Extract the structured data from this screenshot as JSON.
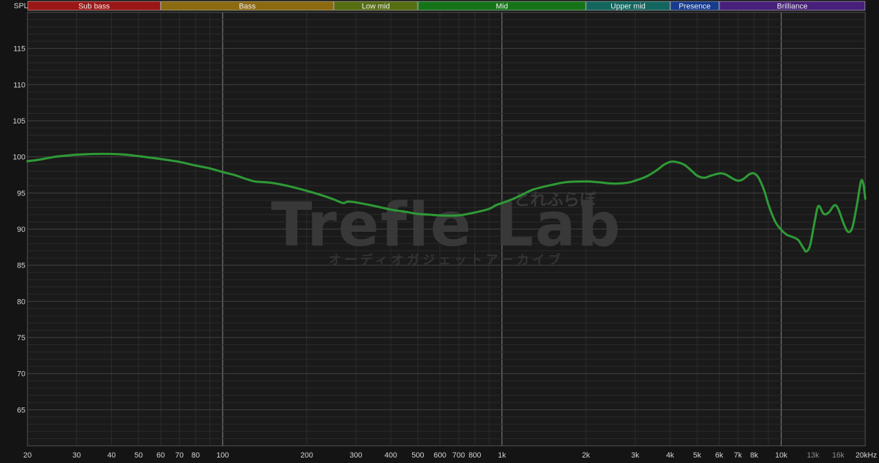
{
  "chart_data": {
    "type": "line",
    "ylabel": "SPL",
    "x_unit": "kHz",
    "x_scale": "log",
    "xlim": [
      20,
      20000
    ],
    "ylim": [
      60,
      120
    ],
    "grid": true,
    "y_ticks": [
      65,
      70,
      75,
      80,
      85,
      90,
      95,
      100,
      105,
      110,
      115
    ],
    "x_ticks": [
      {
        "value": 20,
        "label": "20"
      },
      {
        "value": 30,
        "label": "30"
      },
      {
        "value": 40,
        "label": "40"
      },
      {
        "value": 50,
        "label": "50"
      },
      {
        "value": 60,
        "label": "60"
      },
      {
        "value": 70,
        "label": "70"
      },
      {
        "value": 80,
        "label": "80"
      },
      {
        "value": 100,
        "label": "100"
      },
      {
        "value": 200,
        "label": "200"
      },
      {
        "value": 300,
        "label": "300"
      },
      {
        "value": 400,
        "label": "400"
      },
      {
        "value": 500,
        "label": "500"
      },
      {
        "value": 600,
        "label": "600"
      },
      {
        "value": 700,
        "label": "700"
      },
      {
        "value": 800,
        "label": "800"
      },
      {
        "value": 1000,
        "label": "1k"
      },
      {
        "value": 2000,
        "label": "2k"
      },
      {
        "value": 3000,
        "label": "3k"
      },
      {
        "value": 4000,
        "label": "4k"
      },
      {
        "value": 5000,
        "label": "5k"
      },
      {
        "value": 6000,
        "label": "6k"
      },
      {
        "value": 7000,
        "label": "7k"
      },
      {
        "value": 8000,
        "label": "8k"
      },
      {
        "value": 10000,
        "label": "10k"
      },
      {
        "value": 13000,
        "label": "13k",
        "dim": true
      },
      {
        "value": 16000,
        "label": "16k",
        "dim": true
      },
      {
        "value": 20000,
        "label": "20kHz"
      }
    ],
    "bands": [
      {
        "label": "Sub bass",
        "from": 20,
        "to": 60,
        "color": "#9b1616"
      },
      {
        "label": "Bass",
        "from": 60,
        "to": 250,
        "color": "#8c6a10"
      },
      {
        "label": "Low mid",
        "from": 250,
        "to": 500,
        "color": "#566e12"
      },
      {
        "label": "Mid",
        "from": 500,
        "to": 2000,
        "color": "#157418"
      },
      {
        "label": "Upper mid",
        "from": 2000,
        "to": 4000,
        "color": "#13665e"
      },
      {
        "label": "Presence",
        "from": 4000,
        "to": 6000,
        "color": "#163a8c"
      },
      {
        "label": "Brilliance",
        "from": 6000,
        "to": 20000,
        "color": "#46207a"
      }
    ],
    "series": [
      {
        "color": "#2e9a36",
        "points": [
          [
            20,
            99.4
          ],
          [
            22,
            99.6
          ],
          [
            25,
            100.0
          ],
          [
            28,
            100.2
          ],
          [
            30,
            100.3
          ],
          [
            35,
            100.4
          ],
          [
            40,
            100.4
          ],
          [
            45,
            100.3
          ],
          [
            50,
            100.1
          ],
          [
            60,
            99.7
          ],
          [
            70,
            99.3
          ],
          [
            80,
            98.8
          ],
          [
            90,
            98.4
          ],
          [
            100,
            97.9
          ],
          [
            110,
            97.5
          ],
          [
            120,
            97.0
          ],
          [
            130,
            96.6
          ],
          [
            140,
            96.5
          ],
          [
            150,
            96.4
          ],
          [
            170,
            96.0
          ],
          [
            200,
            95.3
          ],
          [
            230,
            94.6
          ],
          [
            250,
            94.1
          ],
          [
            270,
            93.6
          ],
          [
            280,
            93.8
          ],
          [
            300,
            93.7
          ],
          [
            350,
            93.2
          ],
          [
            400,
            92.7
          ],
          [
            450,
            92.4
          ],
          [
            500,
            92.1
          ],
          [
            550,
            92.0
          ],
          [
            600,
            91.9
          ],
          [
            700,
            91.9
          ],
          [
            800,
            92.3
          ],
          [
            900,
            92.8
          ],
          [
            950,
            93.3
          ],
          [
            1000,
            93.6
          ],
          [
            1100,
            94.2
          ],
          [
            1200,
            94.9
          ],
          [
            1300,
            95.5
          ],
          [
            1500,
            96.1
          ],
          [
            1700,
            96.5
          ],
          [
            2000,
            96.6
          ],
          [
            2200,
            96.5
          ],
          [
            2500,
            96.3
          ],
          [
            2800,
            96.4
          ],
          [
            3000,
            96.7
          ],
          [
            3300,
            97.3
          ],
          [
            3600,
            98.2
          ],
          [
            3800,
            98.9
          ],
          [
            4000,
            99.3
          ],
          [
            4200,
            99.3
          ],
          [
            4500,
            98.9
          ],
          [
            4800,
            98.0
          ],
          [
            5000,
            97.4
          ],
          [
            5300,
            97.1
          ],
          [
            5600,
            97.4
          ],
          [
            6000,
            97.7
          ],
          [
            6300,
            97.6
          ],
          [
            6700,
            97.0
          ],
          [
            7000,
            96.7
          ],
          [
            7300,
            96.9
          ],
          [
            7700,
            97.6
          ],
          [
            8000,
            97.7
          ],
          [
            8300,
            97.1
          ],
          [
            8700,
            95.3
          ],
          [
            9000,
            93.4
          ],
          [
            9500,
            91.1
          ],
          [
            10000,
            89.9
          ],
          [
            10500,
            89.2
          ],
          [
            11000,
            88.9
          ],
          [
            11500,
            88.5
          ],
          [
            12000,
            87.4
          ],
          [
            12300,
            86.9
          ],
          [
            12700,
            87.8
          ],
          [
            13200,
            91.2
          ],
          [
            13600,
            93.2
          ],
          [
            14200,
            92.1
          ],
          [
            14800,
            92.3
          ],
          [
            15500,
            93.3
          ],
          [
            16000,
            92.8
          ],
          [
            16800,
            90.6
          ],
          [
            17400,
            89.6
          ],
          [
            18000,
            90.3
          ],
          [
            18700,
            93.5
          ],
          [
            19300,
            96.6
          ],
          [
            19700,
            96.2
          ],
          [
            20000,
            94.2
          ]
        ]
      }
    ]
  },
  "watermark": {
    "brand": "Trefle Lab",
    "brand_kana": "とれふらぼ",
    "subtitle": "オーディオガジェットアーカイブ"
  }
}
